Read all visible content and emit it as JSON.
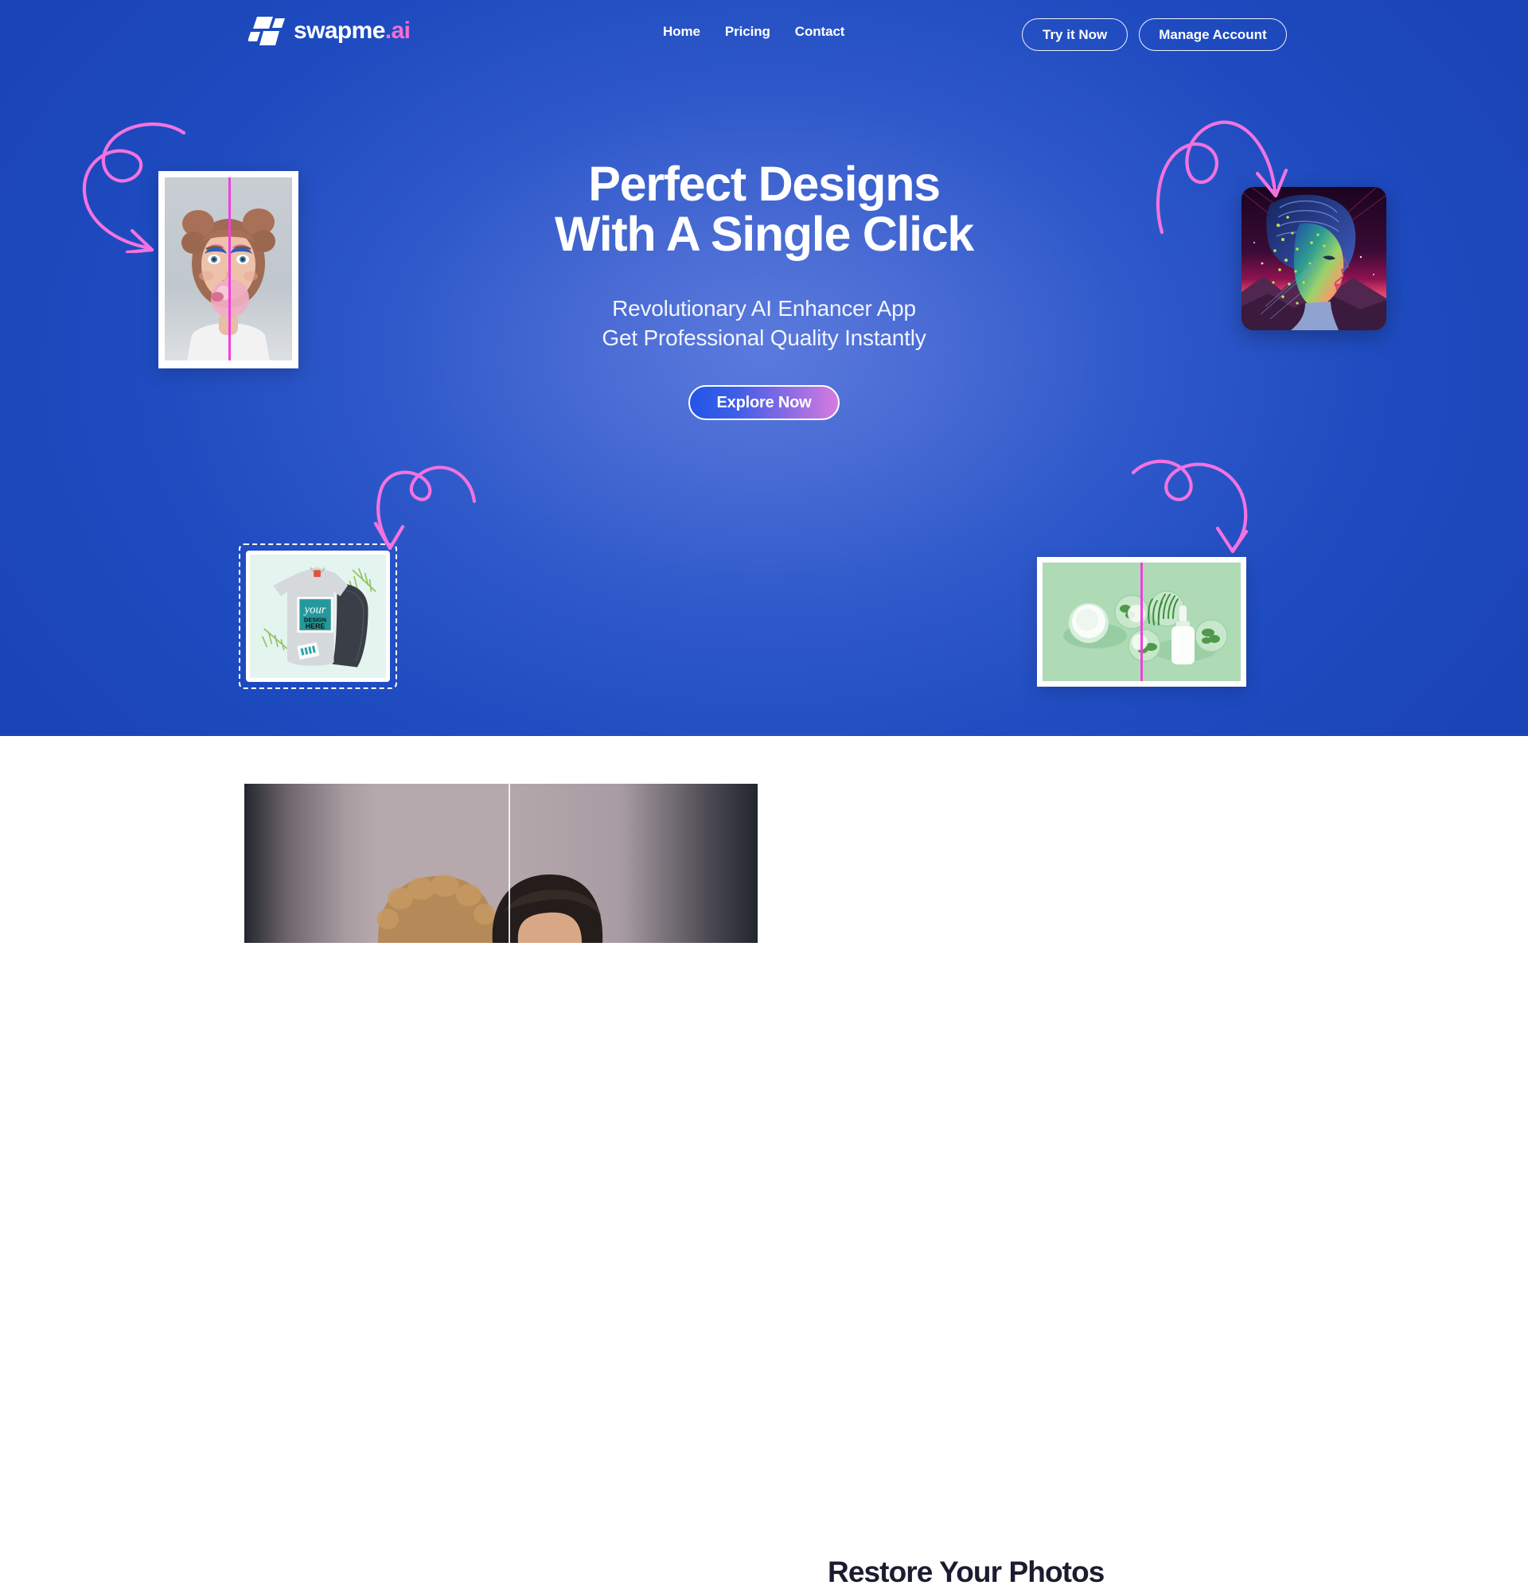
{
  "brand": {
    "name": "swapme",
    "suffix": ".ai",
    "logo_icon": "swapme-parallelogram-logo-icon"
  },
  "nav": {
    "links": [
      {
        "label": "Home"
      },
      {
        "label": "Pricing"
      },
      {
        "label": "Contact"
      }
    ],
    "buttons": [
      {
        "label": "Try it Now"
      },
      {
        "label": "Manage Account"
      }
    ]
  },
  "hero": {
    "heading_line1": "Perfect Designs",
    "heading_line2": "With A Single Click",
    "sub_line1": "Revolutionary AI Enhancer App",
    "sub_line2": "Get Professional Quality Instantly",
    "cta_label": "Explore Now",
    "cards": {
      "portrait": {
        "name": "before-after-portrait-bubblegum",
        "divider_color": "#f23ee0"
      },
      "ai_art": {
        "name": "ai-generated-neon-portrait"
      },
      "tshirt": {
        "name": "tshirt-mockup",
        "print_line1": "your",
        "print_line2": "DESIGN",
        "print_line3": "HERE",
        "print_color": "#24999b"
      },
      "cosmetics": {
        "name": "before-after-cosmetics-flatlay",
        "divider_color": "#f23ee0"
      }
    },
    "arrows": [
      {
        "name": "curly-arrow-top-left"
      },
      {
        "name": "curly-arrow-top-right"
      },
      {
        "name": "curly-arrow-bottom-left"
      },
      {
        "name": "curly-arrow-bottom-right"
      }
    ],
    "colors": {
      "background_edge": "#1f4dc4",
      "background_center": "#5272d8",
      "arrow_pink": "#f273e0",
      "cta_gradient_start": "#2255e8",
      "cta_gradient_end": "#d57be0"
    }
  },
  "section2": {
    "title": "Restore Your Photos",
    "photo_name": "restored-couple-portrait",
    "background": "#ffffff",
    "title_color": "#1b1c30"
  }
}
